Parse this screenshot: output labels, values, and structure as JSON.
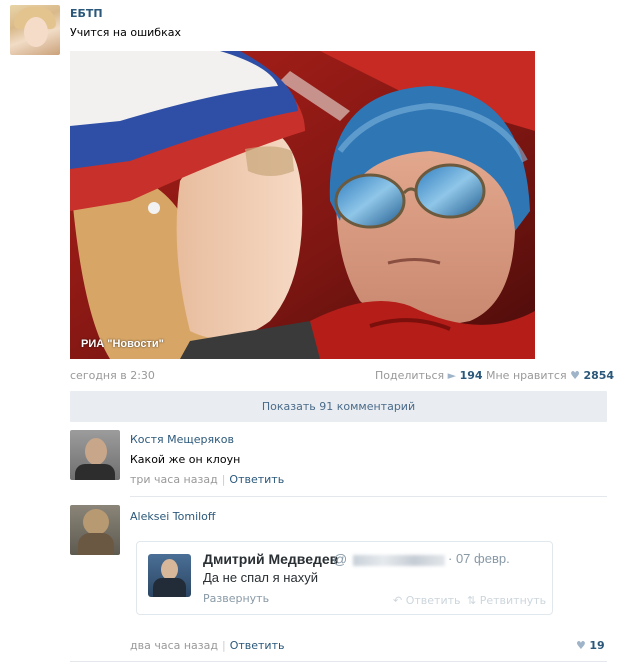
{
  "post": {
    "author": "ЕБТП",
    "text": "Учится на ошибках",
    "photo_caption": "РИА \"Новости\"",
    "date": "сегодня в 2:30",
    "share_label": "Поделиться",
    "share_count": "194",
    "like_label": "Мне нравится",
    "like_count": "2854",
    "show_comments": "Показать 91 комментарий"
  },
  "comments": [
    {
      "author": "Костя Мещеряков",
      "text": "Какой же он клоун",
      "time": "три часа назад",
      "reply_label": "Ответить"
    },
    {
      "author": "Aleksei Tomiloff",
      "time": "два часа назад",
      "reply_label": "Ответить",
      "likes": "19",
      "tweet": {
        "name": "Дмитрий Медведев",
        "handle_prefix": "@",
        "date": "· 07 февр.",
        "text": "Да не спал я нахуй",
        "expand_label": "Развернуть",
        "reply_label": "Ответить",
        "retweet_label": "Ретвитнуть"
      }
    }
  ],
  "icons": {
    "share": "megaphone-icon",
    "like": "heart-icon",
    "reply": "reply-arrow-icon",
    "retweet": "retweet-icon"
  },
  "colors": {
    "link": "#2b587a",
    "muted": "#999999",
    "bar": "#e9edf1"
  }
}
